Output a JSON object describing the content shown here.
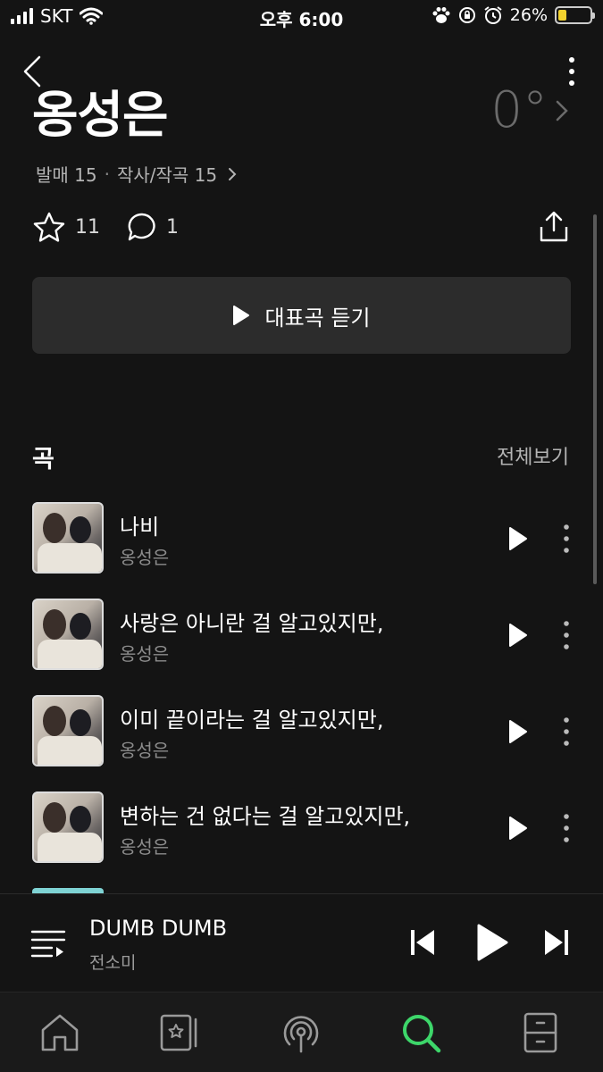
{
  "status": {
    "carrier": "SKT",
    "time": "오후 6:00",
    "battery": "26%",
    "battery_level": 0.26
  },
  "header": {
    "artist": "옹성은",
    "temperature": "0°"
  },
  "meta": {
    "releases": "발매 15",
    "separator": "·",
    "credits": "작사/작곡 15"
  },
  "stats": {
    "likes": "11",
    "comments": "1"
  },
  "play_main": {
    "label": "대표곡 듣기"
  },
  "songs_section": {
    "title": "곡",
    "see_all": "전체보기"
  },
  "songs": [
    {
      "title": "나비",
      "artist": "옹성은"
    },
    {
      "title": "사랑은 아니란 걸 알고있지만,",
      "artist": "옹성은"
    },
    {
      "title": "이미 끝이라는 걸 알고있지만,",
      "artist": "옹성은"
    },
    {
      "title": "변하는 건 없다는 걸 알고있지만,",
      "artist": "옹성은"
    }
  ],
  "now_playing": {
    "title": "DUMB DUMB",
    "artist": "전소미"
  },
  "tabs": [
    "home-icon",
    "library-icon",
    "podcast-icon",
    "search-icon",
    "locker-icon"
  ],
  "colors": {
    "accent": "#3dd66a",
    "background": "#141414",
    "battery": "#f2d22e"
  }
}
